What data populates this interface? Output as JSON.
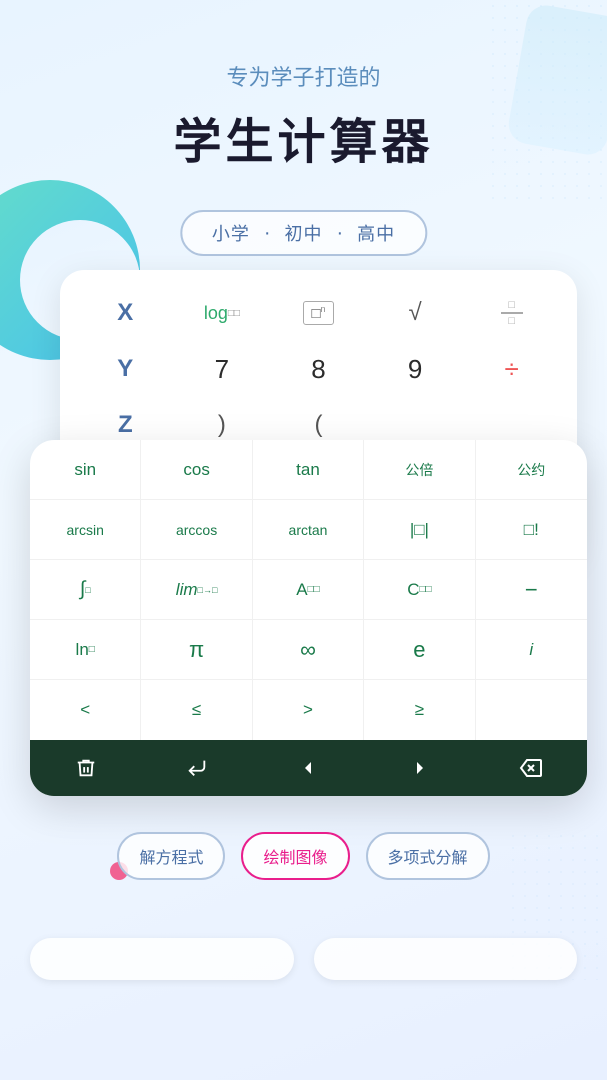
{
  "header": {
    "subtitle": "专为学子打造的",
    "main_title": "学生计算器"
  },
  "levels": {
    "pill_items": [
      "小学",
      "初中",
      "高中"
    ],
    "separators": [
      "·",
      "·"
    ]
  },
  "calc_bg": {
    "row1": [
      "X",
      "log□",
      "□ⁿ",
      "√□",
      "÷frac"
    ],
    "row2": [
      "Y",
      "7",
      "8",
      "9",
      "÷"
    ],
    "row3": [
      "Z",
      "",
      "",
      "",
      ""
    ]
  },
  "keyboard": {
    "rows": [
      [
        "sin",
        "cos",
        "tan",
        "公倍",
        "公约"
      ],
      [
        "arcsin",
        "arccos",
        "arctan",
        "|□|",
        "□!"
      ],
      [
        "∫□",
        "lim",
        "A□",
        "C□",
        "−"
      ],
      [
        "ln□",
        "π",
        "∞",
        "e",
        "i"
      ],
      [
        "<",
        "≤",
        ">",
        "≥",
        ""
      ]
    ],
    "toolbar": [
      "🗑",
      "↩",
      "◁",
      "▷",
      "⌫"
    ]
  },
  "bottom_buttons": [
    {
      "label": "解方程式",
      "type": "normal"
    },
    {
      "label": "绘制图像",
      "type": "pink"
    },
    {
      "label": "多项式分解",
      "type": "normal"
    }
  ],
  "colors": {
    "teal": "#4dd9c0",
    "blue": "#42a5f5",
    "yellow": "#f5c842",
    "pink": "#f06292",
    "green": "#1a7a4a",
    "dark_green": "#1a3a2a",
    "text_blue": "#5b8dbc"
  }
}
